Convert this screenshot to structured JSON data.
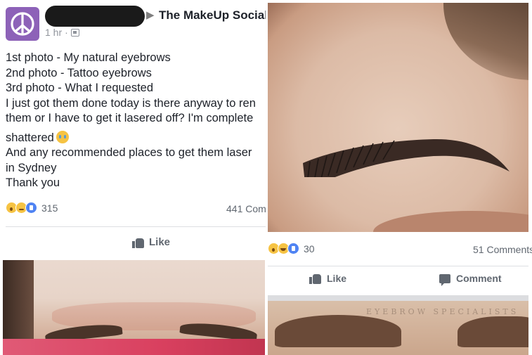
{
  "post": {
    "group_name": "The MakeUp Social",
    "time": "1 hr",
    "lines": [
      "1st photo - My natural eyebrows",
      "2nd photo - Tattoo eyebrows",
      "3rd photo - What I requested",
      "I just got them done today is there anyway to ren",
      "them or I have to get it lasered off? I'm complete",
      "shattered",
      "And any recommended places to get them laser",
      "in Sydney",
      "Thank you"
    ],
    "reaction_count": "315",
    "comment_count": "441 Com",
    "like_label": "Like"
  },
  "right_post": {
    "reaction_count": "30",
    "comment_count": "51 Comments",
    "like_label": "Like",
    "comment_label": "Comment",
    "watermark": "EYEBROW SPECIALISTS"
  },
  "colors": {
    "avatar": "#8d62b8",
    "facebook_gray": "#606770",
    "like_blue": "#4f83f3"
  },
  "icons": [
    "peace-icon",
    "globe-icon",
    "like-thumb-icon",
    "comment-bubble-icon",
    "wow-reaction-icon",
    "sad-reaction-icon",
    "haha-reaction-icon",
    "like-reaction-icon",
    "crying-emoji-icon"
  ]
}
